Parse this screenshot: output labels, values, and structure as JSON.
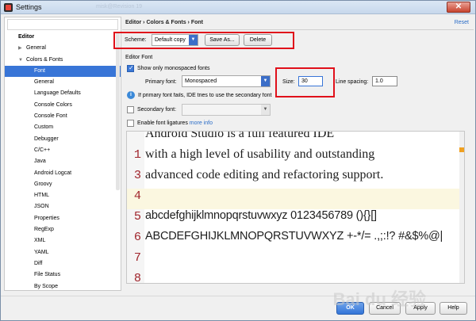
{
  "window": {
    "title": "Settings",
    "bg_text": "misk@Revision 19",
    "close": "✕"
  },
  "sidebar": {
    "items": [
      {
        "label": "Editor",
        "level": 0,
        "selected": false
      },
      {
        "label": "General",
        "level": 1,
        "selected": false,
        "arrow": "▶"
      },
      {
        "label": "Colors & Fonts",
        "level": 1,
        "selected": false,
        "arrow": "▼"
      },
      {
        "label": "Font",
        "level": 2,
        "selected": true
      },
      {
        "label": "General",
        "level": 2,
        "selected": false
      },
      {
        "label": "Language Defaults",
        "level": 2,
        "selected": false
      },
      {
        "label": "Console Colors",
        "level": 2,
        "selected": false
      },
      {
        "label": "Console Font",
        "level": 2,
        "selected": false
      },
      {
        "label": "Custom",
        "level": 2,
        "selected": false
      },
      {
        "label": "Debugger",
        "level": 2,
        "selected": false
      },
      {
        "label": "C/C++",
        "level": 2,
        "selected": false
      },
      {
        "label": "Java",
        "level": 2,
        "selected": false
      },
      {
        "label": "Android Logcat",
        "level": 2,
        "selected": false
      },
      {
        "label": "Groovy",
        "level": 2,
        "selected": false
      },
      {
        "label": "HTML",
        "level": 2,
        "selected": false
      },
      {
        "label": "JSON",
        "level": 2,
        "selected": false
      },
      {
        "label": "Properties",
        "level": 2,
        "selected": false
      },
      {
        "label": "RegExp",
        "level": 2,
        "selected": false
      },
      {
        "label": "XML",
        "level": 2,
        "selected": false
      },
      {
        "label": "YAML",
        "level": 2,
        "selected": false
      },
      {
        "label": "Diff",
        "level": 2,
        "selected": false
      },
      {
        "label": "File Status",
        "level": 2,
        "selected": false
      },
      {
        "label": "By Scope",
        "level": 2,
        "selected": false
      }
    ]
  },
  "header": {
    "breadcrumb": "Editor › Colors & Fonts › Font",
    "reset": "Reset"
  },
  "scheme": {
    "label": "Scheme:",
    "value": "Default copy",
    "save_as": "Save As...",
    "delete": "Delete"
  },
  "editor_font": {
    "section_label": "Editor Font",
    "monospaced_label": "Show only monospaced fonts",
    "primary_label": "Primary font:",
    "primary_value": "Monospaced",
    "size_label": "Size:",
    "size_value": "30",
    "line_spacing_label": "Line spacing:",
    "line_spacing_value": "1.0",
    "info_text": "If primary font fails, IDE tries to use the secondary font",
    "secondary_label": "Secondary font:",
    "secondary_value": "",
    "ligatures_label": "Enable font ligatures",
    "more_info": "more info"
  },
  "preview": {
    "lines": [
      {
        "num": "",
        "text": "Android Studio is a full featured IDE"
      },
      {
        "num": "1",
        "text": "with a high level of usability and outstanding"
      },
      {
        "num": "3",
        "text": "advanced code editing and refactoring support."
      },
      {
        "num": "4",
        "text": ""
      },
      {
        "num": "5",
        "text": "abcdefghijklmnopqrstuvwxyz 0123456789 (){}[]"
      },
      {
        "num": "6",
        "text": "ABCDEFGHIJKLMNOPQRSTUVWXYZ +-*/= .,;:!? #&$%@|"
      },
      {
        "num": "7",
        "text": ""
      },
      {
        "num": "8",
        "text": ""
      }
    ]
  },
  "footer": {
    "ok": "OK",
    "cancel": "Cancel",
    "apply": "Apply",
    "help": "Help",
    "watermark": "Bai du 经验"
  },
  "colors": {
    "accent": "#3875d7",
    "highlight_box": "#e0101a",
    "line_number": "#a0252c"
  }
}
